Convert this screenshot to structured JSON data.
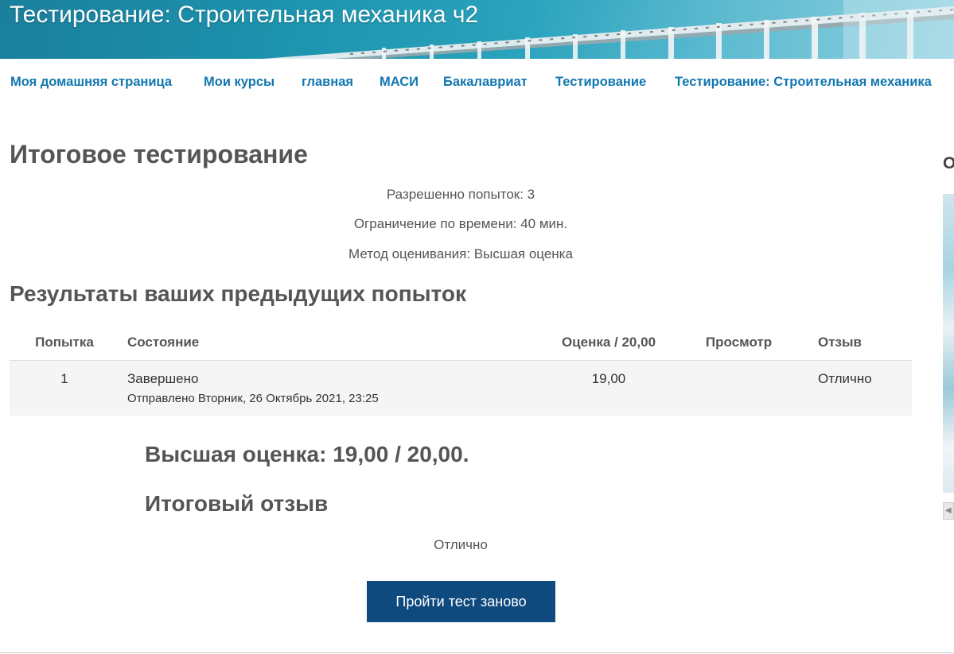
{
  "header": {
    "title": "Тестирование: Строительная механика ч2"
  },
  "breadcrumb": [
    "Моя домашняя страница",
    "Мои курсы",
    "главная",
    "МАСИ",
    "Бакалавриат",
    "Тестирование",
    "Тестирование: Строительная механика"
  ],
  "side_block": {
    "heading_partial": "О"
  },
  "quiz": {
    "title": "Итоговое тестирование",
    "attempts_allowed": "Разрешенно попыток: 3",
    "time_limit": "Ограничение по времени: 40 мин.",
    "grading_method": "Метод оценивания: Высшая оценка"
  },
  "results": {
    "title": "Результаты ваших предыдущих попыток",
    "columns": {
      "attempt": "Попытка",
      "state": "Состояние",
      "grade": "Оценка / 20,00",
      "review": "Просмотр",
      "feedback": "Отзыв"
    },
    "rows": [
      {
        "attempt": "1",
        "state": "Завершено",
        "submitted": "Отправлено Вторник, 26 Октябрь 2021, 23:25",
        "grade": "19,00",
        "review": "",
        "feedback": "Отлично"
      }
    ]
  },
  "summary": {
    "best_grade": "Высшая оценка: 19,00 / 20,00.",
    "overall_feedback_title": "Итоговый отзыв",
    "overall_feedback": "Отлично"
  },
  "actions": {
    "retry_label": "Пройти тест заново"
  },
  "colors": {
    "link": "#1177b0",
    "button": "#0e4a7e",
    "text": "#555555"
  }
}
